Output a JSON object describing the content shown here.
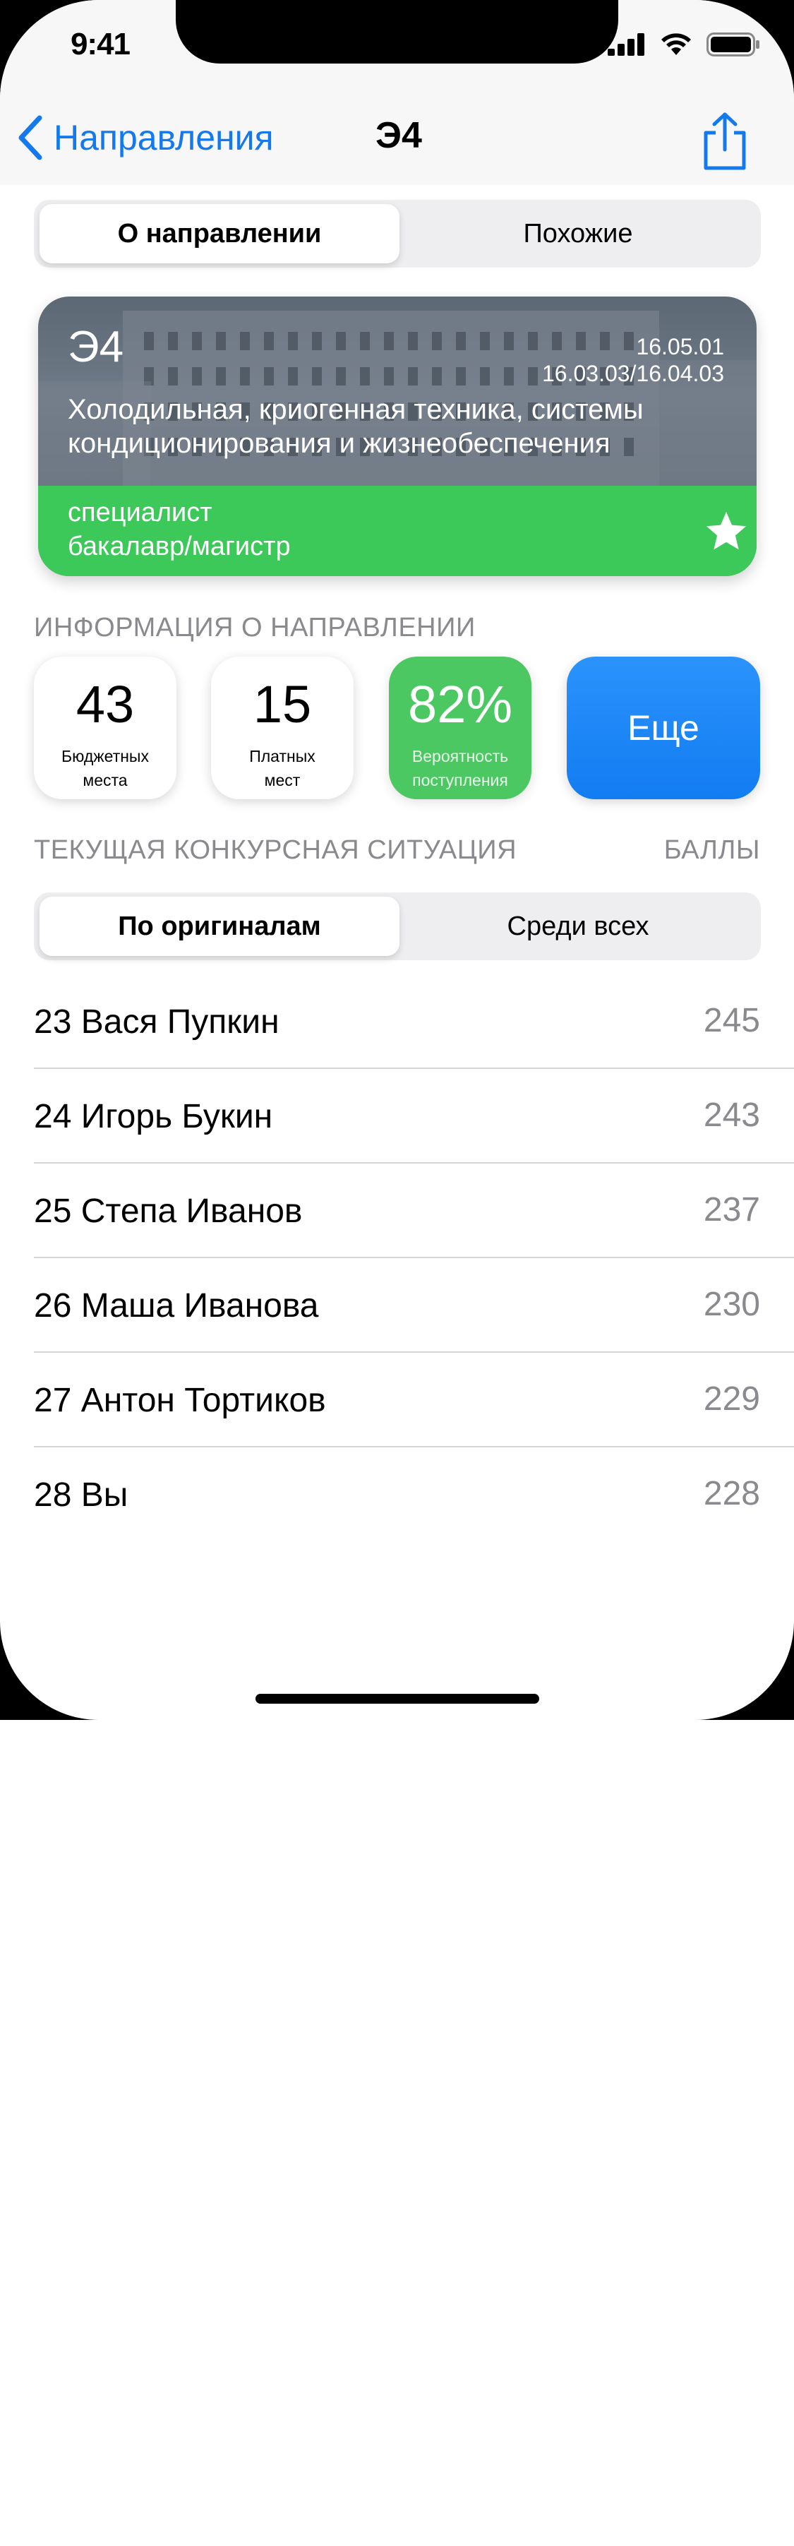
{
  "status_bar": {
    "time": "9:41"
  },
  "nav": {
    "back_label": "Направления",
    "title": "Э4"
  },
  "top_segment": {
    "items": [
      "О направлении",
      "Похожие"
    ],
    "selected": 0
  },
  "program_card": {
    "code": "Э4",
    "specialty_codes": [
      "16.05.01",
      "16.03.03/16.04.03"
    ],
    "description_lines": [
      "Холодильная, криогенная техника, системы",
      "кондиционирования и жизнеобеспечения"
    ],
    "levels": [
      "специалист",
      "бакалавр/магистр"
    ],
    "favorite": true
  },
  "info_section": {
    "title": "ИНФОРМАЦИЯ О НАПРАВЛЕНИИ",
    "stats": [
      {
        "value": "43",
        "label_lines": [
          "Бюджетных",
          "места"
        ]
      },
      {
        "value": "15",
        "label_lines": [
          "Платных",
          "мест"
        ]
      },
      {
        "value": "82%",
        "label_lines": [
          "Вероятность",
          "поступления"
        ]
      }
    ],
    "more_label": "Еще"
  },
  "competition_section": {
    "title": "ТЕКУЩАЯ КОНКУРСНАЯ СИТУАЦИЯ",
    "score_header": "БАЛЛЫ"
  },
  "list_segment": {
    "items": [
      "По оригиналам",
      "Среди всех"
    ],
    "selected": 0
  },
  "ranking": [
    {
      "name": "23 Вася Пупкин",
      "score": "245"
    },
    {
      "name": "24 Игорь Букин",
      "score": "243"
    },
    {
      "name": "25 Степа Иванов",
      "score": "237"
    },
    {
      "name": "26 Маша Иванова",
      "score": "230"
    },
    {
      "name": "27 Антон Тортиков",
      "score": "229"
    },
    {
      "name": "28 Вы",
      "score": "228"
    }
  ],
  "colors": {
    "accent": "#1479ec",
    "green": "#3dc95a",
    "secondary_text": "#8a8a8e"
  }
}
